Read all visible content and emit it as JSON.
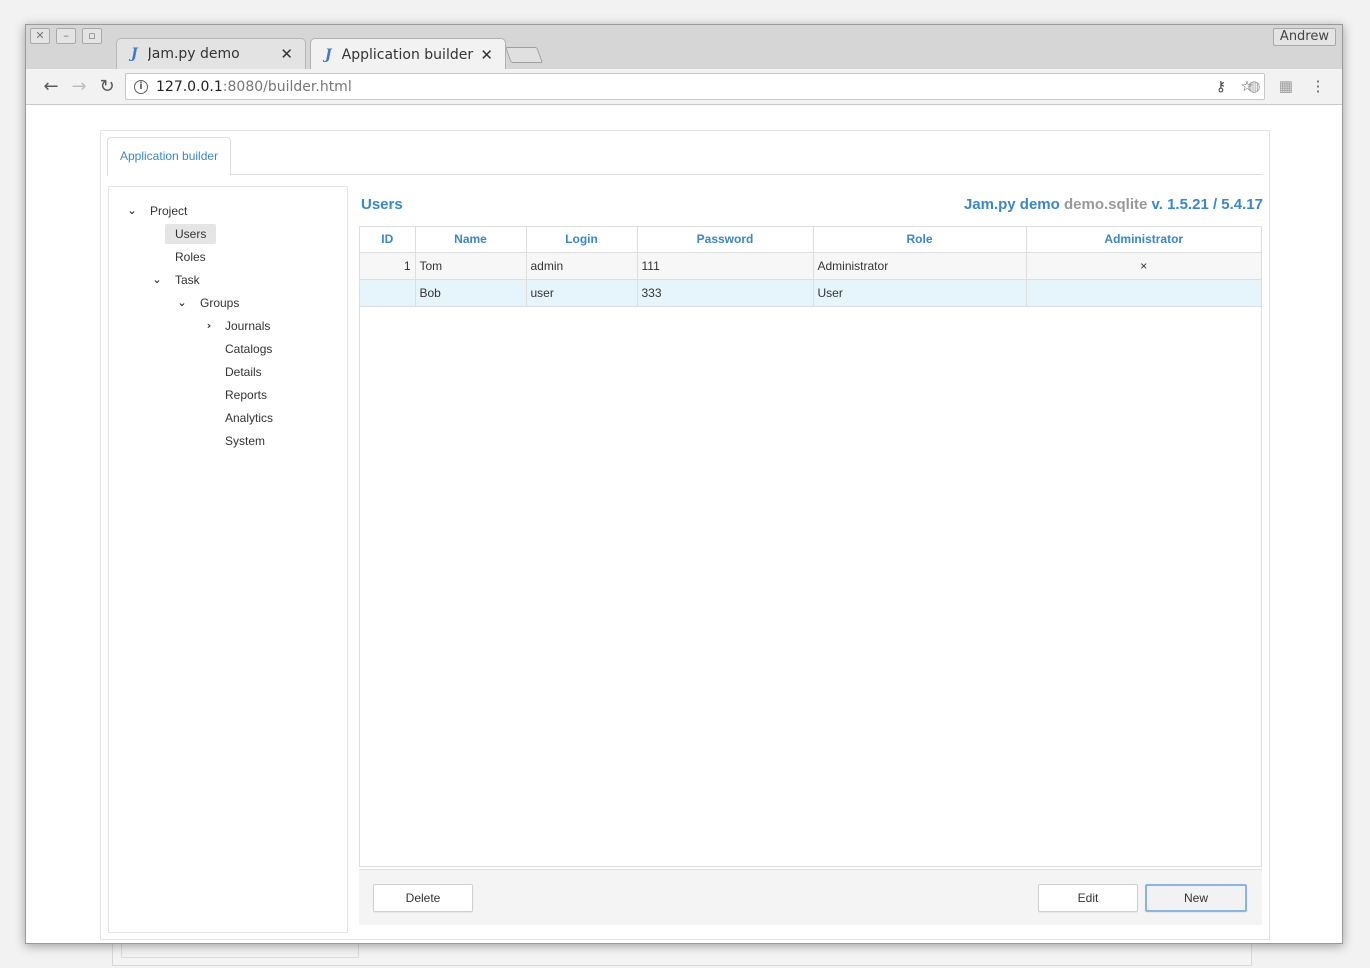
{
  "browser": {
    "user": "Andrew",
    "tabs": [
      {
        "title": "Jam.py demo",
        "favicon": "J",
        "active": false
      },
      {
        "title": "Application builder",
        "favicon": "J",
        "active": true
      }
    ],
    "address": {
      "host": "127.0.0.1",
      "path": ":8080/builder.html"
    }
  },
  "app": {
    "tab_label": "Application builder",
    "tree": {
      "project": "Project",
      "users": "Users",
      "roles": "Roles",
      "task": "Task",
      "groups": "Groups",
      "journals": "Journals",
      "catalogs": "Catalogs",
      "details": "Details",
      "reports": "Reports",
      "analytics": "Analytics",
      "system": "System"
    },
    "view_title": "Users",
    "version": {
      "project": "Jam.py demo",
      "db": "demo.sqlite",
      "ver": "v. 1.5.21 / 5.4.17"
    },
    "table": {
      "columns": [
        "ID",
        "Name",
        "Login",
        "Password",
        "Role",
        "Administrator"
      ],
      "rows": [
        {
          "id": "1",
          "name": "Tom",
          "login": "admin",
          "password": "111",
          "role": "Administrator",
          "admin": "×"
        },
        {
          "id": "",
          "name": "Bob",
          "login": "user",
          "password": "333",
          "role": "User",
          "admin": ""
        }
      ]
    },
    "buttons": {
      "delete": "Delete",
      "edit": "Edit",
      "new": "New"
    }
  },
  "colors": {
    "accent": "#3a87c9",
    "selected_row": "#e6f4fb"
  }
}
